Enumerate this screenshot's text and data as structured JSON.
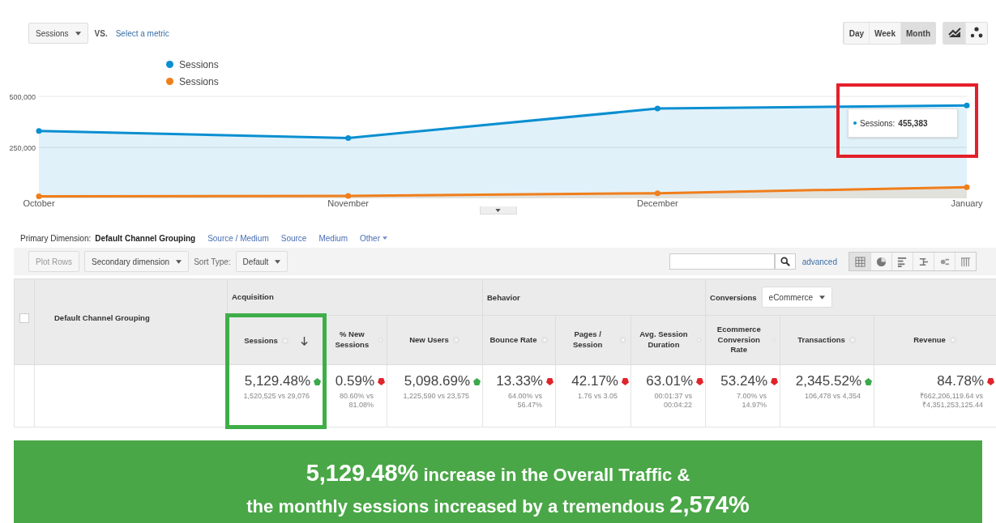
{
  "chart_controls": {
    "metric": "Sessions",
    "vs": "VS.",
    "compare_link": "Select a metric",
    "periods": [
      {
        "label": "Day",
        "selected": false
      },
      {
        "label": "Week",
        "selected": false
      },
      {
        "label": "Month",
        "selected": true
      }
    ],
    "chart_types": [
      {
        "kind": "line",
        "selected": true
      },
      {
        "kind": "motion",
        "selected": false
      }
    ]
  },
  "chart": {
    "chart_data": {
      "type": "area",
      "categories": [
        "October",
        "November",
        "December",
        "January"
      ],
      "series": [
        {
          "name": "Sessions",
          "color": "#0a8fd1",
          "values": [
            330000,
            296000,
            440000,
            455383
          ]
        },
        {
          "name": "Sessions",
          "color": "#f07e1b",
          "values": [
            10000,
            12000,
            25000,
            55000
          ]
        }
      ],
      "ylim": [
        0,
        500000
      ],
      "yticks": [
        {
          "value": 250000,
          "label": "250,000"
        },
        {
          "value": 500000,
          "label": "500,000"
        }
      ]
    },
    "tooltip": {
      "label": "Sessions:",
      "value": "455,383",
      "highlighted": true
    }
  },
  "dimensions": {
    "label": "Primary Dimension:",
    "items": [
      {
        "label": "Default Channel Grouping",
        "selected": true
      },
      {
        "label": "Source / Medium",
        "selected": false
      },
      {
        "label": "Source",
        "selected": false
      },
      {
        "label": "Medium",
        "selected": false
      },
      {
        "label": "Other",
        "selected": false,
        "kind": "menu"
      }
    ]
  },
  "toolbar": {
    "plot_rows": {
      "label": "Plot Rows",
      "disabled": true
    },
    "secondary": "Secondary dimension",
    "sort_label": "Sort Type:",
    "sort": "Default",
    "advanced": "advanced",
    "views": [
      {
        "kind": "table",
        "selected": true
      },
      {
        "kind": "pie",
        "selected": false
      },
      {
        "kind": "bars",
        "selected": false
      },
      {
        "kind": "compare",
        "selected": false
      },
      {
        "kind": "terms",
        "selected": false
      },
      {
        "kind": "pivot",
        "selected": false
      }
    ]
  },
  "table": {
    "select_all_checked": false,
    "dimension_header": "Default Channel Grouping",
    "groups": [
      {
        "label": "Acquisition",
        "columns": [
          {
            "header": "Sessions",
            "sorted": true,
            "highlighted": true,
            "value": "5,129.48%",
            "rising": true,
            "comparison": "1,520,525 vs 29,076"
          },
          {
            "header": "% New Sessions",
            "sorted": false,
            "highlighted": false,
            "value": "0.59%",
            "rising": false,
            "comparison": "80.60% vs 81.08%"
          },
          {
            "header": "New Users",
            "sorted": false,
            "highlighted": false,
            "value": "5,098.69%",
            "rising": true,
            "comparison": "1,225,590 vs 23,575"
          }
        ]
      },
      {
        "label": "Behavior",
        "columns": [
          {
            "header": "Bounce Rate",
            "sorted": false,
            "highlighted": false,
            "value": "13.33%",
            "rising": false,
            "comparison": "64.00% vs 56.47%"
          },
          {
            "header": "Pages / Session",
            "sorted": false,
            "highlighted": false,
            "value": "42.17%",
            "rising": false,
            "comparison": "1.76 vs 3.05"
          },
          {
            "header": "Avg. Session Duration",
            "sorted": false,
            "highlighted": false,
            "value": "63.01%",
            "rising": false,
            "comparison": "00:01:37 vs 00:04:22"
          }
        ]
      },
      {
        "label": "Conversions",
        "dropdown": "eCommerce",
        "columns": [
          {
            "header": "Ecommerce Conversion Rate",
            "sorted": false,
            "highlighted": false,
            "value": "53.24%",
            "rising": false,
            "comparison": "7.00% vs 14.97%"
          },
          {
            "header": "Transactions",
            "sorted": false,
            "highlighted": false,
            "value": "2,345.52%",
            "rising": true,
            "comparison": "106,478 vs 4,354"
          },
          {
            "header": "Revenue",
            "sorted": false,
            "highlighted": false,
            "value": "84.78%",
            "rising": false,
            "comparison": "₹662,206,119.64 vs ₹4,351,253,125.44"
          }
        ]
      }
    ]
  },
  "banner": {
    "lines": [
      "**5,129.48%** increase in the Overall Traffic &",
      "the monthly sessions increased by a tremendous **2,574%**"
    ]
  }
}
